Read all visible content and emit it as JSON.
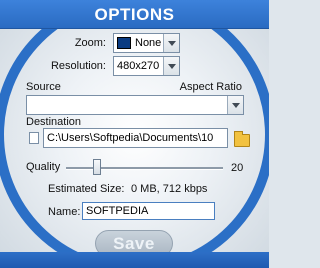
{
  "window": {
    "title": "OPTIONS"
  },
  "zoom": {
    "label": "Zoom:",
    "value": "None"
  },
  "resolution": {
    "label": "Resolution:",
    "value": "480x270"
  },
  "source": {
    "label": "Source",
    "value": ""
  },
  "aspect_ratio": {
    "label": "Aspect Ratio"
  },
  "destination": {
    "label": "Destination",
    "value": "C:\\Users\\Softpedia\\Documents\\10"
  },
  "quality": {
    "label": "Quality",
    "value": 20,
    "min": 0,
    "max": 100,
    "value_text": "20"
  },
  "estimated": {
    "label": "Estimated Size:",
    "value": "0 MB, 712 kbps"
  },
  "name": {
    "label": "Name:",
    "value": "SOFTPEDIA"
  },
  "save": {
    "label": "Save"
  },
  "colors": {
    "frame": "#2b6fc6",
    "title_text": "#ffffff",
    "zoom_swatch": "#0a3b82"
  }
}
